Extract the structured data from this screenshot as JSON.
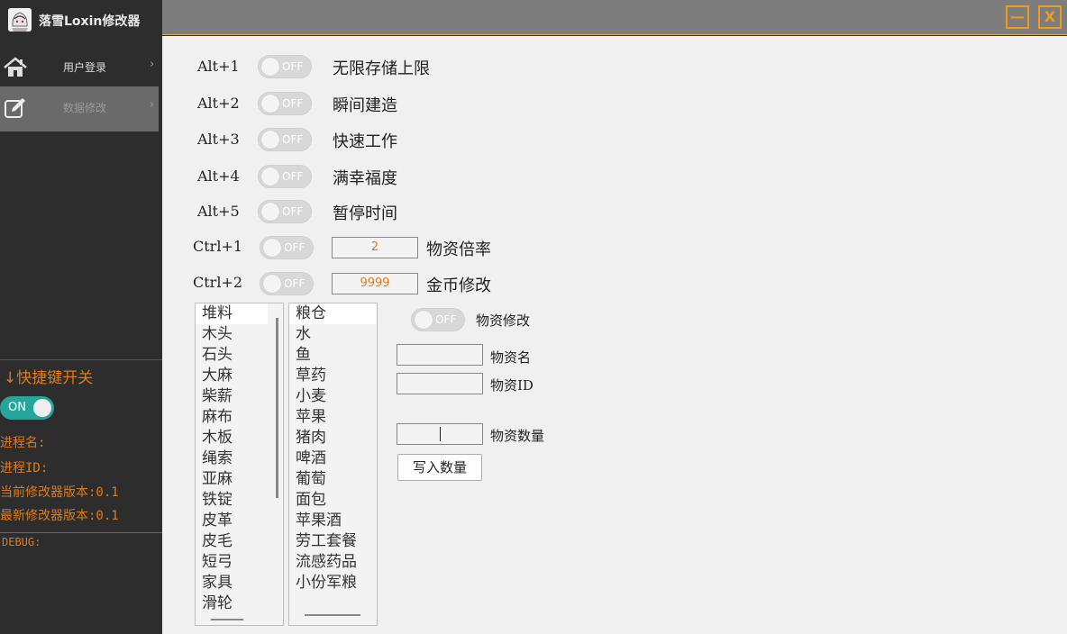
{
  "app": {
    "title": "落雪Loxin修改器"
  },
  "nav": [
    {
      "label": "用户登录"
    },
    {
      "label": "数据修改"
    }
  ],
  "sidebar": {
    "hotkey_title": "↓快捷键开关",
    "master_toggle": {
      "label": "ON",
      "state": "on"
    },
    "process_name": "进程名:",
    "process_id": "进程ID:",
    "current_version": "当前修改器版本:0.1",
    "latest_version": "最新修改器版本:0.1",
    "debug_label": "DEBUG:"
  },
  "window_buttons": {
    "minimize": "—",
    "close": "X"
  },
  "hotkeys": [
    {
      "key": "Alt+1",
      "toggle": "OFF",
      "label": "无限存储上限"
    },
    {
      "key": "Alt+2",
      "toggle": "OFF",
      "label": "瞬间建造"
    },
    {
      "key": "Alt+3",
      "toggle": "OFF",
      "label": "快速工作"
    },
    {
      "key": "Alt+4",
      "toggle": "OFF",
      "label": "满幸福度"
    },
    {
      "key": "Alt+5",
      "toggle": "OFF",
      "label": "暂停时间"
    },
    {
      "key": "Ctrl+1",
      "toggle": "OFF",
      "value": "2",
      "label": "物资倍率"
    },
    {
      "key": "Ctrl+2",
      "toggle": "OFF",
      "value": "9999",
      "label": "金币修改"
    }
  ],
  "list_left": [
    "堆料",
    "木头",
    "石头",
    "大麻",
    "柴薪",
    "麻布",
    "木板",
    "绳索",
    "亚麻",
    "铁锭",
    "皮革",
    "皮毛",
    "短弓",
    "家具",
    "滑轮"
  ],
  "list_right": [
    "粮仓",
    "水",
    "鱼",
    "草药",
    "小麦",
    "苹果",
    "猪肉",
    "啤酒",
    "葡萄",
    "面包",
    "苹果酒",
    "劳工套餐",
    "流感药品",
    "小份军粮"
  ],
  "resource_panel": {
    "toggle": "OFF",
    "toggle_label": "物资修改",
    "name_label": "物资名",
    "id_label": "物资ID",
    "qty_label": "物资数量",
    "write_button": "写入数量"
  }
}
